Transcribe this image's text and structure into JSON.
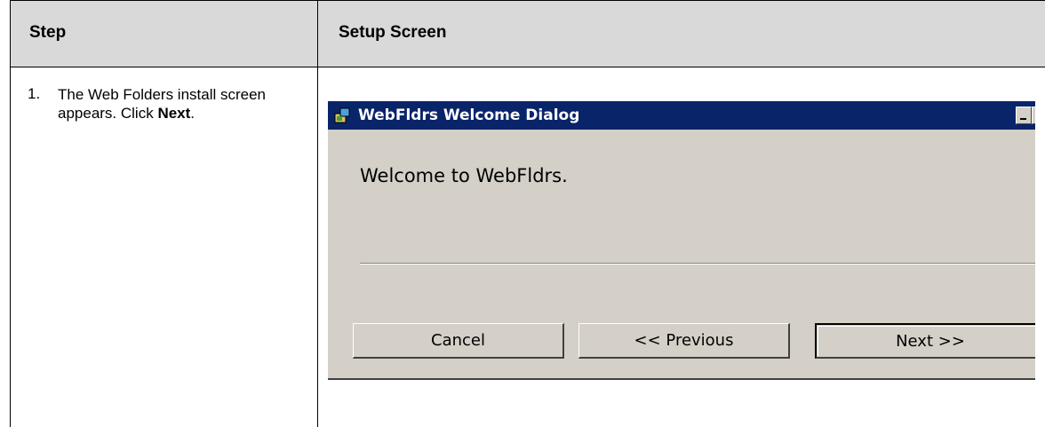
{
  "table": {
    "headers": {
      "step": "Step",
      "setup": "Setup Screen"
    },
    "row": {
      "number": "1.",
      "text_before": "The Web Folders install screen appears. Click ",
      "text_bold": "Next",
      "text_after": "."
    }
  },
  "dialog": {
    "title": "WebFldrs Welcome Dialog",
    "welcome": "Welcome to WebFldrs.",
    "buttons": {
      "cancel": "Cancel",
      "previous": "<< Previous",
      "next": "Next >>"
    },
    "colors": {
      "titlebar": "#0a246a",
      "face": "#d4d0c8"
    }
  }
}
